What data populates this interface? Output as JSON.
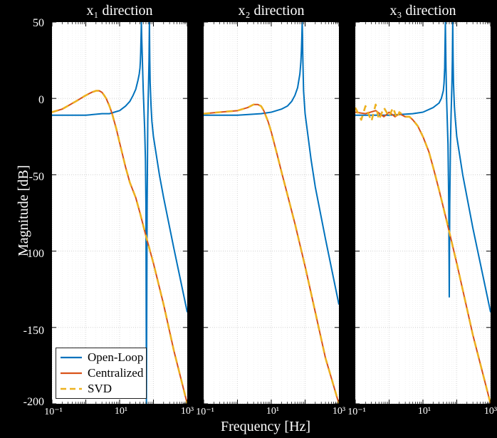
{
  "chart_data": [
    {
      "type": "line",
      "title": "x₁ direction",
      "xlabel": "",
      "ylabel": "Magnitude [dB]",
      "xscale": "log",
      "xlim": [
        0.1,
        1000
      ],
      "ylim": [
        -200,
        50
      ],
      "xticks": [
        0.1,
        1,
        10,
        100,
        1000
      ],
      "xtick_labels": [
        "10⁻¹",
        "10⁰",
        "10¹",
        "10²",
        "10³"
      ],
      "yticks": [
        -200,
        -150,
        -100,
        -50,
        0,
        50
      ],
      "series": [
        {
          "name": "Open-Loop",
          "color": "#0072bd",
          "style": "solid",
          "x": [
            0.1,
            0.3,
            1,
            3,
            5,
            7,
            10,
            15,
            20,
            25,
            30,
            35,
            38,
            40,
            41,
            42,
            43,
            44,
            45,
            50,
            55,
            58,
            60,
            62,
            65,
            68,
            70,
            72,
            74,
            76,
            78,
            80,
            85,
            90,
            100,
            150,
            200,
            400,
            1000
          ],
          "y": [
            -11,
            -11,
            -11,
            -10,
            -10,
            -9,
            -8,
            -5,
            -2,
            2,
            6,
            12,
            16,
            20,
            24,
            30,
            40,
            50,
            40,
            5,
            -20,
            -40,
            -70,
            -200,
            -70,
            -15,
            0,
            12,
            25,
            50,
            25,
            10,
            -5,
            -15,
            -25,
            -50,
            -65,
            -98,
            -140
          ]
        },
        {
          "name": "Centralized",
          "color": "#d95319",
          "style": "solid",
          "x": [
            0.1,
            0.2,
            0.5,
            1,
            1.5,
            2,
            2.5,
            3,
            3.5,
            4,
            5,
            6,
            8,
            10,
            15,
            20,
            30,
            40,
            60,
            100,
            200,
            400,
            1000
          ],
          "y": [
            -9,
            -7,
            -2,
            2,
            4,
            5,
            5,
            4,
            2,
            0,
            -5,
            -10,
            -20,
            -29,
            -45,
            -55,
            -65,
            -75,
            -90,
            -108,
            -135,
            -165,
            -200
          ]
        },
        {
          "name": "SVD",
          "color": "#edb120",
          "style": "dashed",
          "x": [
            0.1,
            0.2,
            0.5,
            1,
            1.5,
            2,
            2.5,
            3,
            3.5,
            4,
            5,
            6,
            8,
            10,
            15,
            20,
            30,
            40,
            60,
            100,
            200,
            400,
            1000
          ],
          "y": [
            -9,
            -7,
            -2,
            2,
            4,
            5,
            5,
            4,
            2,
            0,
            -5,
            -10,
            -20,
            -29,
            -45,
            -55,
            -65,
            -75,
            -90,
            -108,
            -135,
            -165,
            -200
          ]
        }
      ]
    },
    {
      "type": "line",
      "title": "x₂ direction",
      "xlabel": "",
      "ylabel": "",
      "xscale": "log",
      "xlim": [
        0.1,
        1000
      ],
      "ylim": [
        -200,
        50
      ],
      "xticks": [
        0.1,
        1,
        10,
        100,
        1000
      ],
      "xtick_labels": [
        "10⁻¹",
        "10⁰",
        "10¹",
        "10²",
        "10³"
      ],
      "yticks": [
        -200,
        -150,
        -100,
        -50,
        0,
        50
      ],
      "series": [
        {
          "name": "Open-Loop",
          "color": "#0072bd",
          "style": "solid",
          "x": [
            0.1,
            0.5,
            1,
            5,
            10,
            20,
            30,
            40,
            50,
            60,
            70,
            75,
            78,
            80,
            82,
            84,
            85,
            90,
            100,
            150,
            200,
            400,
            1000
          ],
          "y": [
            -11,
            -11,
            -11,
            -10,
            -9,
            -7,
            -5,
            -2,
            2,
            7,
            16,
            24,
            32,
            40,
            50,
            40,
            30,
            5,
            -10,
            -40,
            -58,
            -92,
            -135
          ]
        },
        {
          "name": "Centralized",
          "color": "#d95319",
          "style": "solid",
          "x": [
            0.1,
            0.3,
            1,
            2,
            3,
            4,
            5,
            6,
            8,
            10,
            15,
            20,
            30,
            50,
            100,
            200,
            400,
            1000
          ],
          "y": [
            -10,
            -9,
            -8,
            -6,
            -4,
            -4,
            -5,
            -8,
            -15,
            -22,
            -37,
            -48,
            -63,
            -82,
            -110,
            -140,
            -170,
            -200
          ]
        },
        {
          "name": "SVD",
          "color": "#edb120",
          "style": "dashed",
          "x": [
            0.1,
            0.3,
            1,
            2,
            3,
            4,
            5,
            6,
            8,
            10,
            15,
            20,
            30,
            50,
            100,
            200,
            400,
            1000
          ],
          "y": [
            -10,
            -9,
            -8,
            -6,
            -4,
            -4,
            -5,
            -8,
            -15,
            -22,
            -37,
            -48,
            -63,
            -82,
            -110,
            -140,
            -170,
            -200
          ]
        }
      ]
    },
    {
      "type": "line",
      "title": "x₃ direction",
      "xlabel": "",
      "ylabel": "",
      "xscale": "log",
      "xlim": [
        0.1,
        1000
      ],
      "ylim": [
        -200,
        50
      ],
      "xticks": [
        0.1,
        1,
        10,
        100,
        1000
      ],
      "xtick_labels": [
        "10⁻¹",
        "10⁰",
        "10¹",
        "10²",
        "10³"
      ],
      "yticks": [
        -200,
        -150,
        -100,
        -50,
        0,
        50
      ],
      "series": [
        {
          "name": "Open-Loop",
          "color": "#0072bd",
          "style": "solid",
          "x": [
            0.1,
            1,
            5,
            10,
            20,
            30,
            35,
            40,
            42,
            44,
            46,
            48,
            50,
            55,
            58,
            60,
            62,
            65,
            68,
            70,
            72,
            74,
            76,
            78,
            80,
            85,
            90,
            100,
            150,
            300,
            1000
          ],
          "y": [
            -11,
            -11,
            -10,
            -9,
            -6,
            -3,
            0,
            5,
            10,
            20,
            50,
            20,
            0,
            -30,
            -70,
            -130,
            -70,
            -30,
            -10,
            0,
            10,
            25,
            50,
            25,
            10,
            -5,
            -13,
            -25,
            -50,
            -85,
            -140
          ]
        },
        {
          "name": "Centralized",
          "color": "#d95319",
          "style": "solid",
          "x": [
            0.1,
            0.2,
            0.4,
            0.7,
            1,
            1.5,
            2,
            3,
            4,
            5,
            7,
            10,
            15,
            20,
            30,
            50,
            100,
            300,
            1000
          ],
          "y": [
            -9,
            -10,
            -8,
            -12,
            -9,
            -12,
            -10,
            -12,
            -12,
            -14,
            -18,
            -25,
            -35,
            -45,
            -60,
            -80,
            -108,
            -155,
            -200
          ]
        },
        {
          "name": "SVD",
          "color": "#edb120",
          "style": "dashed",
          "x": [
            0.1,
            0.15,
            0.2,
            0.3,
            0.4,
            0.5,
            0.7,
            1,
            1.3,
            1.7,
            2,
            3,
            4,
            5,
            7,
            10,
            15,
            20,
            30,
            50,
            100,
            300,
            1000
          ],
          "y": [
            -6,
            -14,
            -5,
            -15,
            -4,
            -14,
            -6,
            -12,
            -6,
            -13,
            -9,
            -12,
            -12,
            -14,
            -18,
            -25,
            -35,
            -45,
            -60,
            -80,
            -108,
            -155,
            -200
          ]
        }
      ]
    }
  ],
  "shared_xlabel": "Frequency [Hz]",
  "legend": {
    "items": [
      {
        "label": "Open-Loop",
        "color": "#0072bd",
        "style": "solid"
      },
      {
        "label": "Centralized",
        "color": "#d95319",
        "style": "solid"
      },
      {
        "label": "SVD",
        "color": "#edb120",
        "style": "dashed"
      }
    ]
  }
}
